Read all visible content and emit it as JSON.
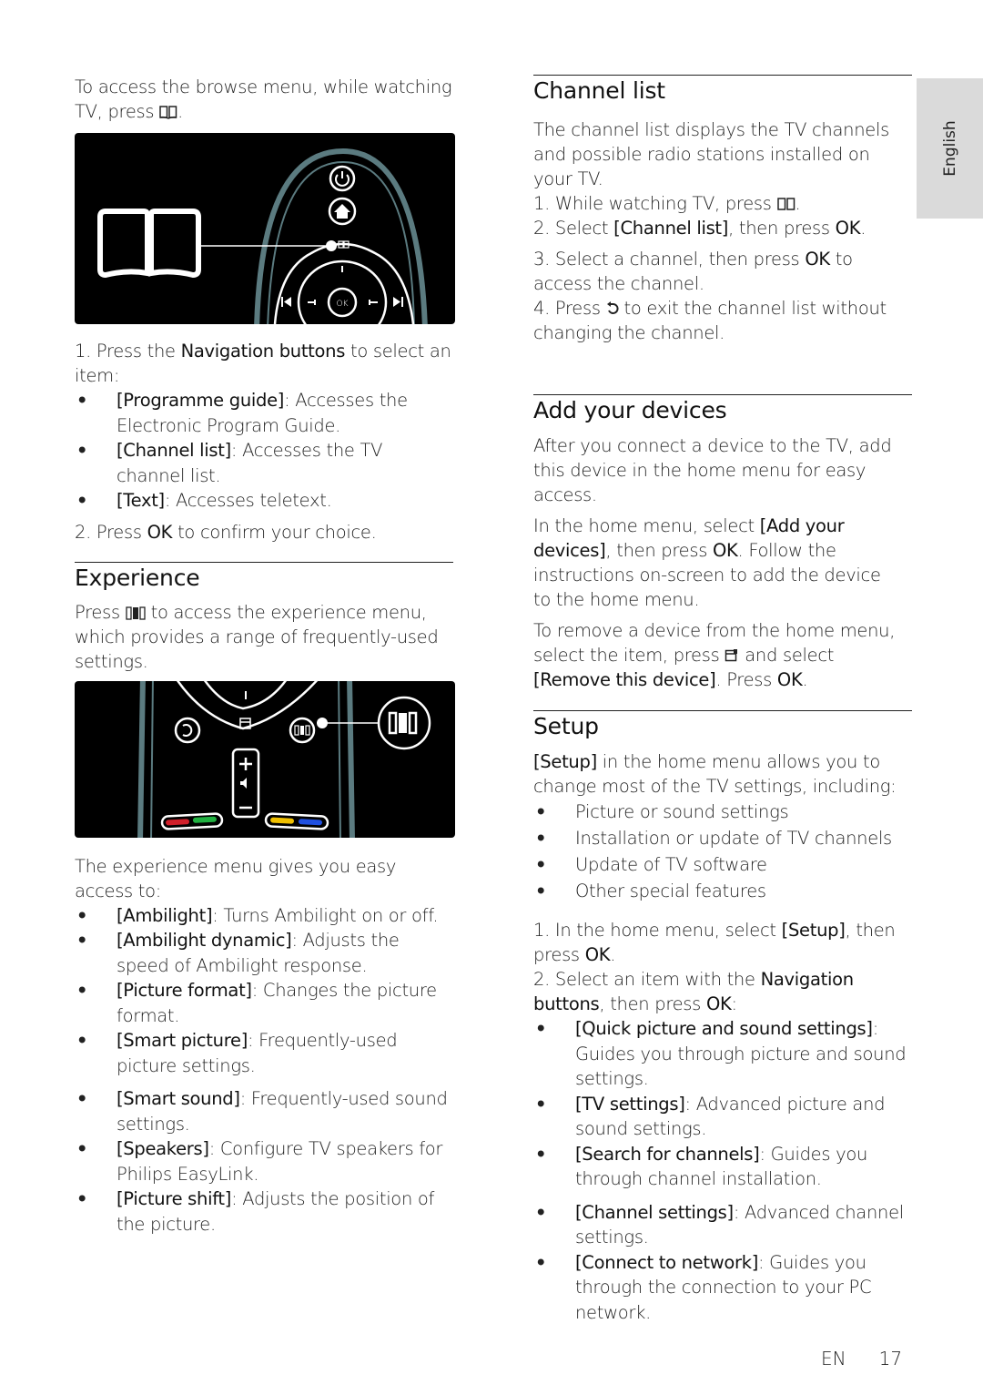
{
  "side_tab": {
    "language": "English"
  },
  "footer": {
    "lang_code": "EN",
    "page_number": "17"
  },
  "icons": {
    "browse": "browse-book-icon",
    "back": "back-arrow-icon",
    "options": "options-icon",
    "experience": "experience-icon"
  },
  "left": {
    "intro": {
      "before": "To access the browse menu, while watching TV, press ",
      "after": "."
    },
    "figure1": {
      "ok_label": "OK"
    },
    "nav_step": {
      "prefix": "1. Press the ",
      "bold": "Navigation buttons",
      "suffix": " to select an item:"
    },
    "browse_items": [
      {
        "term": "[Programme guide]",
        "desc": ": Accesses the Electronic Program Guide."
      },
      {
        "term": "[Channel list]",
        "desc": ": Accesses the TV channel list."
      },
      {
        "term": "[Text]",
        "desc": ": Accesses teletext."
      }
    ],
    "confirm_step": {
      "prefix": "2. Press ",
      "bold": "OK",
      "suffix": " to confirm your choice."
    },
    "experience": {
      "heading": "Experience",
      "intro_before": "Press ",
      "intro_after": " to access the experience menu, which provides a range of frequently-used settings.",
      "access_text": "The experience menu gives you easy access to:",
      "items": [
        {
          "term": "[Ambilight]",
          "desc": ": Turns Ambilight on or off."
        },
        {
          "term": "[Ambilight dynamic]",
          "desc": ": Adjusts the speed of Ambilight response."
        },
        {
          "term": "[Picture format]",
          "desc": ": Changes the picture format."
        },
        {
          "term": "[Smart picture]",
          "desc": ": Frequently-used picture settings."
        },
        {
          "term": "[Smart sound]",
          "desc": ": Frequently-used sound settings."
        },
        {
          "term": "[Speakers]",
          "desc": ": Configure TV speakers for Philips EasyLink."
        },
        {
          "term": "[Picture shift]",
          "desc": ": Adjusts the position of the picture."
        }
      ],
      "color_keys": [
        "#d0202a",
        "#20b040",
        "#f0c000",
        "#2050e0"
      ]
    }
  },
  "right": {
    "channel_list": {
      "heading": "Channel list",
      "intro": "The channel list displays the TV channels and possible radio stations installed on your TV.",
      "step1_before": "1. While watching TV, press ",
      "step1_after": ".",
      "step2": {
        "prefix": "2. Select ",
        "bold": "[Channel list]",
        "mid": ", then press ",
        "bold2": "OK",
        "suffix": "."
      },
      "step3": {
        "prefix": "3. Select a channel, then press ",
        "bold": "OK",
        "suffix": " to access the channel."
      },
      "step4_before": "4. Press ",
      "step4_after": " to exit the channel list without changing the channel."
    },
    "add_devices": {
      "heading": "Add your devices",
      "p1": "After you connect a device to the TV, add this device in the home menu for easy access.",
      "p2": {
        "prefix": "In the home menu, select ",
        "bold": "[Add your devices]",
        "mid": ", then press ",
        "bold2": "OK",
        "suffix": ". Follow the instructions on-screen to add the device to the home menu."
      },
      "p3": {
        "prefix": "To remove a device from the home menu, select the item, press ",
        "mid": " and select ",
        "bold": "[Remove this device]",
        "mid2": ". Press ",
        "bold2": "OK",
        "suffix": "."
      }
    },
    "setup": {
      "heading": "Setup",
      "intro": {
        "bold": "[Setup]",
        "suffix": " in the home menu allows you to change most of the TV settings, including:"
      },
      "features": [
        "Picture or sound settings",
        "Installation or update of TV channels",
        "Update of TV software",
        "Other special features"
      ],
      "step1": {
        "prefix": "1. In the home menu, select ",
        "bold": "[Setup]",
        "mid": ", then press ",
        "bold2": "OK",
        "suffix": "."
      },
      "step2": {
        "prefix": "2. Select an item with the ",
        "bold": "Navigation buttons",
        "mid": ", then press ",
        "bold2": "OK",
        "suffix": ":"
      },
      "items": [
        {
          "term": "[Quick picture and sound settings]",
          "desc": ": Guides you through picture and sound settings."
        },
        {
          "term": "[TV settings]",
          "desc": ": Advanced picture and sound settings."
        },
        {
          "term": "[Search for channels]",
          "desc": ": Guides you through channel installation."
        },
        {
          "term": "[Channel settings]",
          "desc": ": Advanced channel settings."
        },
        {
          "term": "[Connect to network]",
          "desc": ": Guides you through the connection to your PC network."
        }
      ]
    }
  }
}
